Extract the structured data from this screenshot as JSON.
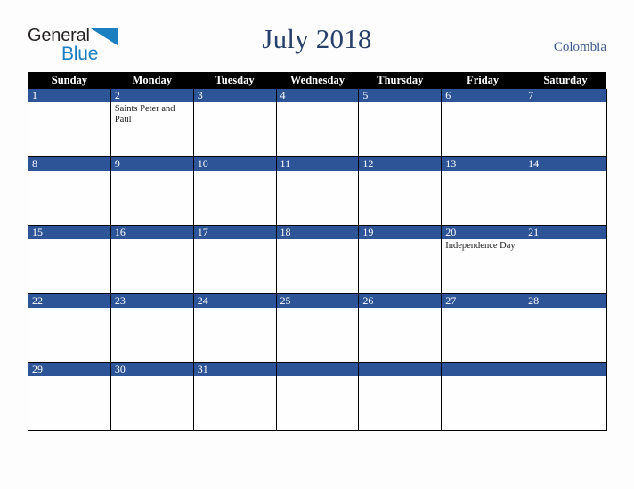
{
  "brand": {
    "name_part1": "General",
    "name_part2": "Blue",
    "triangle_icon": "triangle-icon",
    "accent_color": "#1a7fc1",
    "text_color": "#231f20"
  },
  "header": {
    "title": "July 2018",
    "country": "Colombia",
    "title_color": "#27406b",
    "country_color": "#3d5a8a"
  },
  "calendar": {
    "month": "July",
    "year": "2018",
    "weekday_headers": [
      "Sunday",
      "Monday",
      "Tuesday",
      "Wednesday",
      "Thursday",
      "Friday",
      "Saturday"
    ],
    "header_bg": "#000000",
    "header_fg": "#ffffff",
    "daynum_bg": "#2d5496",
    "daynum_fg": "#ffffff",
    "grid_line_color": "#000000",
    "cell_bg": "#fefefe",
    "weeks": [
      [
        {
          "day": "1",
          "events": []
        },
        {
          "day": "2",
          "events": [
            "Saints Peter and Paul"
          ]
        },
        {
          "day": "3",
          "events": []
        },
        {
          "day": "4",
          "events": []
        },
        {
          "day": "5",
          "events": []
        },
        {
          "day": "6",
          "events": []
        },
        {
          "day": "7",
          "events": []
        }
      ],
      [
        {
          "day": "8",
          "events": []
        },
        {
          "day": "9",
          "events": []
        },
        {
          "day": "10",
          "events": []
        },
        {
          "day": "11",
          "events": []
        },
        {
          "day": "12",
          "events": []
        },
        {
          "day": "13",
          "events": []
        },
        {
          "day": "14",
          "events": []
        }
      ],
      [
        {
          "day": "15",
          "events": []
        },
        {
          "day": "16",
          "events": []
        },
        {
          "day": "17",
          "events": []
        },
        {
          "day": "18",
          "events": []
        },
        {
          "day": "19",
          "events": []
        },
        {
          "day": "20",
          "events": [
            "Independence Day"
          ]
        },
        {
          "day": "21",
          "events": []
        }
      ],
      [
        {
          "day": "22",
          "events": []
        },
        {
          "day": "23",
          "events": []
        },
        {
          "day": "24",
          "events": []
        },
        {
          "day": "25",
          "events": []
        },
        {
          "day": "26",
          "events": []
        },
        {
          "day": "27",
          "events": []
        },
        {
          "day": "28",
          "events": []
        }
      ],
      [
        {
          "day": "29",
          "events": []
        },
        {
          "day": "30",
          "events": []
        },
        {
          "day": "31",
          "events": []
        },
        {
          "day": "",
          "events": []
        },
        {
          "day": "",
          "events": []
        },
        {
          "day": "",
          "events": []
        },
        {
          "day": "",
          "events": []
        }
      ]
    ]
  }
}
